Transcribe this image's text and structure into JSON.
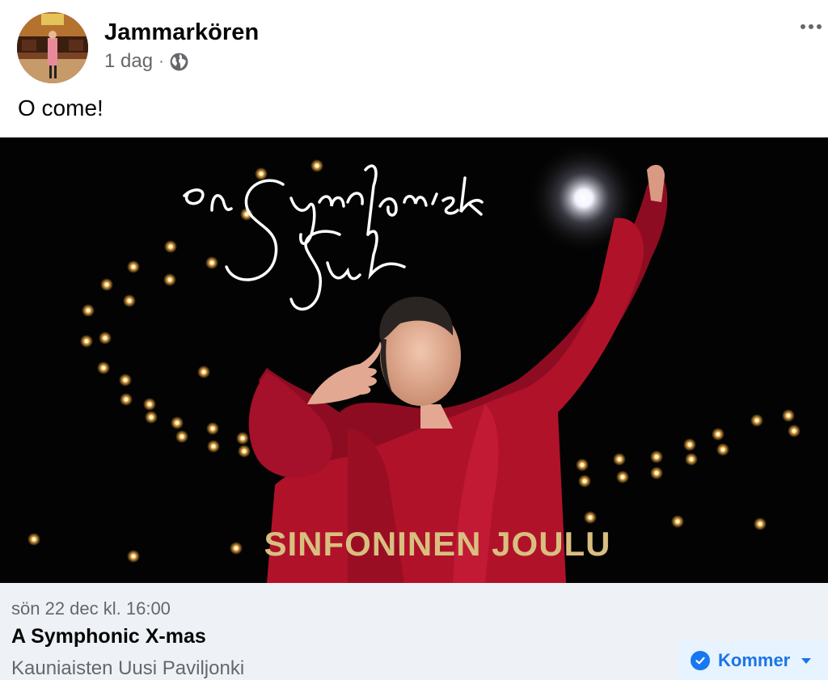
{
  "post": {
    "page_name": "Jammarkören",
    "time": "1 dag",
    "separator": "·",
    "privacy_icon": "globe-icon",
    "text": "O come!",
    "more_icon": "more-dots-icon"
  },
  "media": {
    "script_title": "en Symfonisk Jul",
    "banner_text": "SINFONINEN JOULU",
    "colors": {
      "coat": "#b0122a",
      "gold": "#d8bf80",
      "background": "#030303"
    }
  },
  "event": {
    "date": "sön 22 dec kl. 16:00",
    "title": "A Symphonic X-mas",
    "location": "Kauniaisten Uusi Paviljonki",
    "rsvp": {
      "label": "Kommer",
      "icon": "check-circle-icon",
      "dropdown_icon": "caret-down-icon"
    }
  },
  "colors": {
    "accent": "#1b74e4",
    "secondary_text": "#65676b",
    "event_bg": "#eef2f7"
  }
}
